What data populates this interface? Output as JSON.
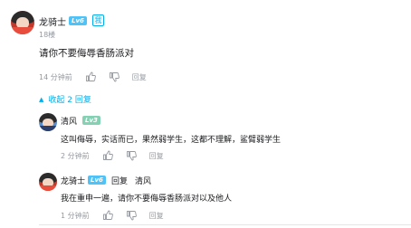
{
  "comment": {
    "username": "龙骑士",
    "level": "Lv6",
    "me_badge": "我",
    "floor": "18楼",
    "text": "请你不要侮辱香肠派对",
    "time": "14 分钟前",
    "reply_label": "回复"
  },
  "collapse": {
    "label": "收起 2 回复"
  },
  "replies": [
    {
      "username": "清风",
      "level": "Lv3",
      "text": "这叫侮辱，实话而已，果然弱学生，这都不理解，鲨臂弱学生",
      "time": "2 分钟前",
      "reply_label": "回复"
    },
    {
      "username": "龙骑士",
      "level": "Lv6",
      "reply_word": "回复",
      "reply_target": "清风",
      "text": "我在重申一遍，请你不要侮辱香肠派对以及他人",
      "time": "1 分钟前",
      "reply_label": "回复"
    }
  ],
  "colors": {
    "accent": "#00aeec",
    "muted": "#9499a0",
    "text": "#18191c",
    "lv6": "#4fc3f7",
    "lv3": "#85d1b3"
  }
}
